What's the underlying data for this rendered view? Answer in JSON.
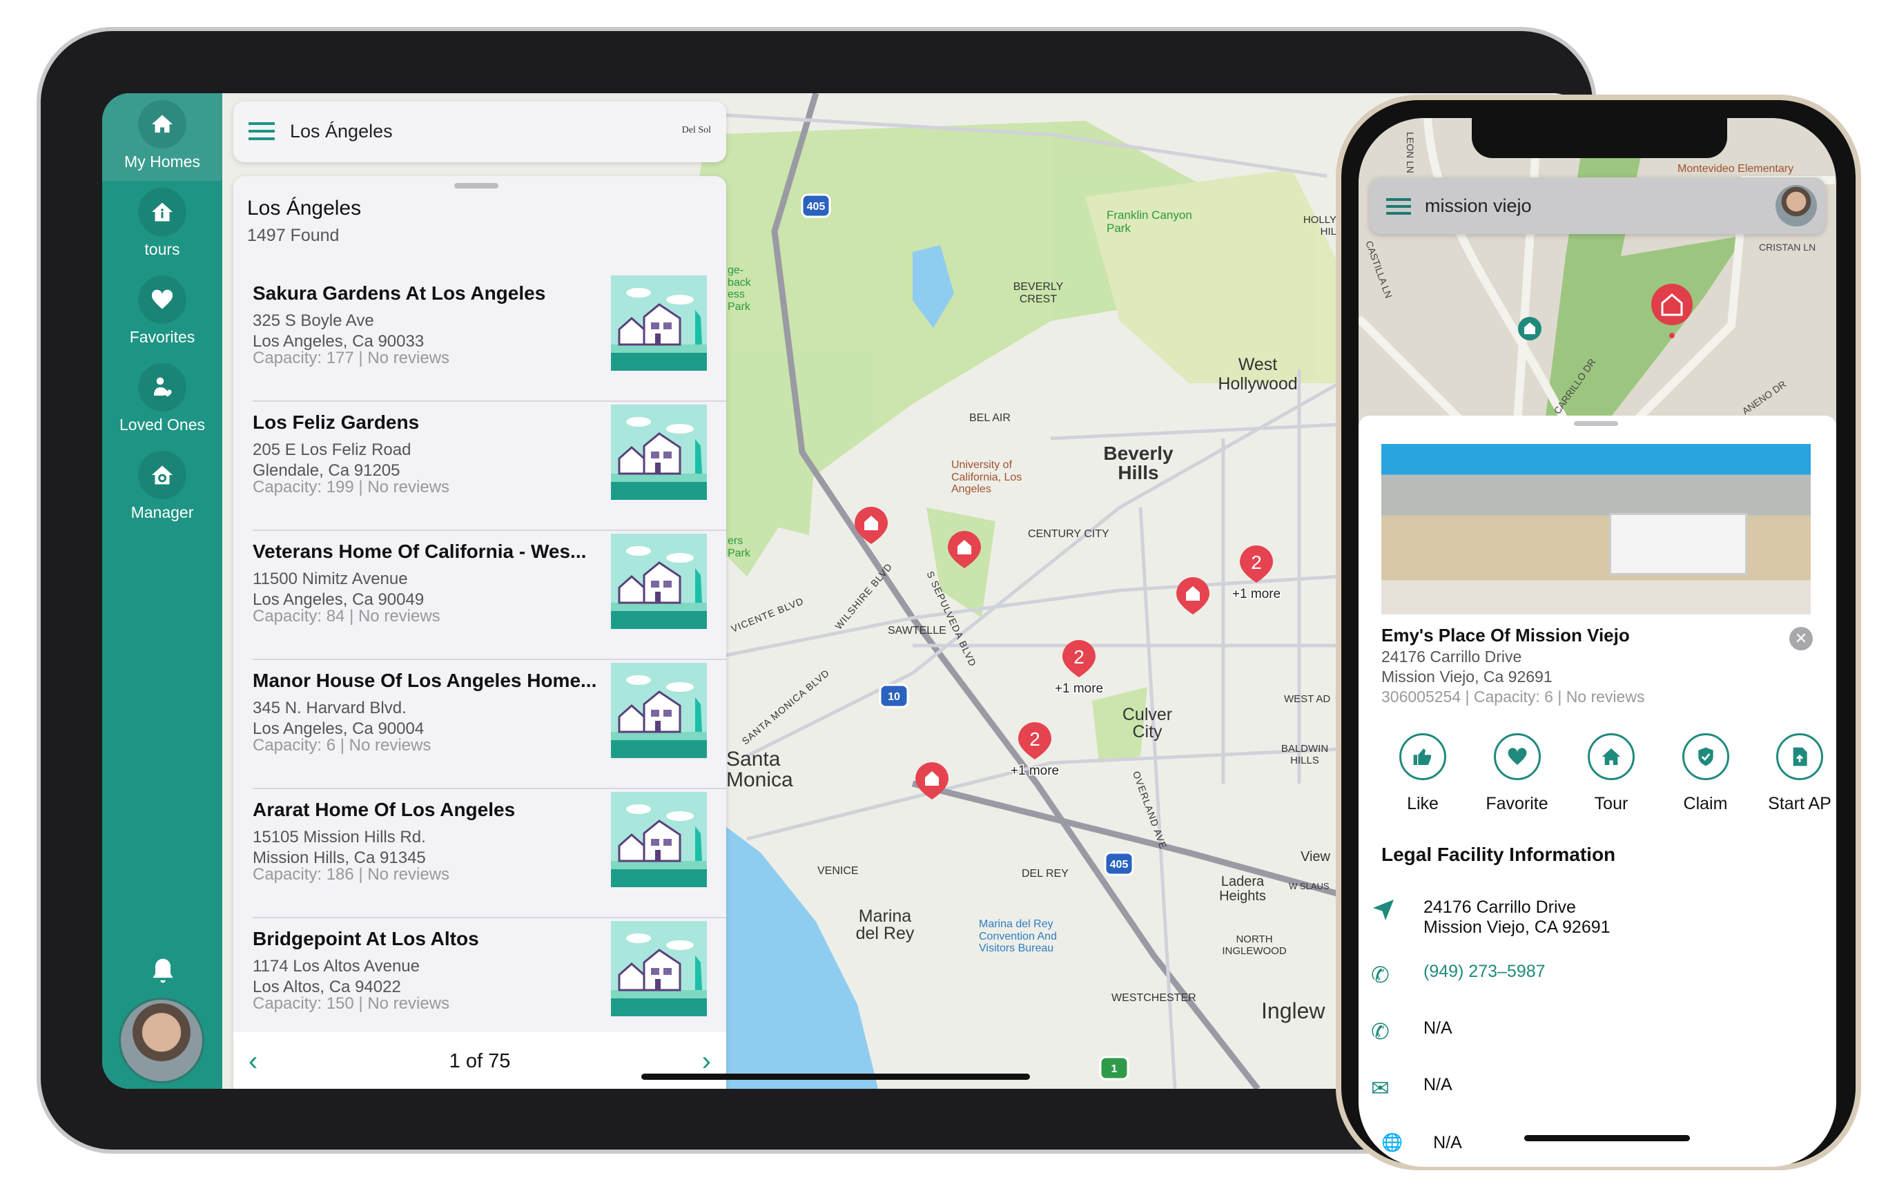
{
  "colors": {
    "brand": "#1e9484",
    "pin": "#e5434f",
    "map_bg": "#eeeee8",
    "park": "#bfe0a0"
  },
  "ipad": {
    "sidebar": {
      "items": [
        {
          "label": "My Homes",
          "icon": "home-icon",
          "active": true
        },
        {
          "label": "tours",
          "icon": "home-info-icon"
        },
        {
          "label": "Favorites",
          "icon": "heart-icon"
        },
        {
          "label": "Loved Ones",
          "icon": "person-heart-icon"
        },
        {
          "label": "Manager",
          "icon": "home-gear-icon"
        }
      ],
      "bell_icon": "bell-icon",
      "avatar": "user-avatar"
    },
    "search": {
      "value": "Los Ángeles",
      "logo": "Del Sol"
    },
    "results": {
      "title": "Los Ángeles",
      "count": "1497 Found",
      "items": [
        {
          "name": "Sakura Gardens At Los Angeles",
          "line1": "325 S Boyle Ave",
          "line2": "Los Angeles, Ca 90033",
          "meta": "Capacity: 177 | No reviews"
        },
        {
          "name": "Los Feliz Gardens",
          "line1": "205 E Los Feliz Road",
          "line2": "Glendale, Ca 91205",
          "meta": "Capacity: 199 | No reviews"
        },
        {
          "name": "Veterans Home Of California - Wes...",
          "line1": "11500 Nimitz Avenue",
          "line2": "Los Angeles, Ca 90049",
          "meta": "Capacity: 84 | No reviews"
        },
        {
          "name": "Manor House Of Los Angeles Home...",
          "line1": "345 N. Harvard Blvd.",
          "line2": "Los Angeles, Ca 90004",
          "meta": "Capacity: 6 | No reviews"
        },
        {
          "name": "Ararat Home Of Los Angeles",
          "line1": "15105 Mission Hills Rd.",
          "line2": "Mission Hills, Ca 91345",
          "meta": "Capacity: 186 | No reviews"
        },
        {
          "name": "Bridgepoint At Los Altos",
          "line1": "1174 Los Altos Avenue",
          "line2": "Los Altos, Ca 94022",
          "meta": "Capacity: 150 | No reviews"
        }
      ],
      "pagination": "1 of 75"
    },
    "map": {
      "labels": {
        "franklin": "Franklin Canyon Park",
        "beverly_crest": "BEVERLY CREST",
        "west_hollywood": "West Hollywood",
        "bel_air": "BEL AIR",
        "ucla": "University of California, Los Angeles",
        "beverly_hills": "Beverly Hills",
        "century_city": "CENTURY CITY",
        "sawtelle": "SAWTELLE",
        "culver_city": "Culver City",
        "santa_monica": "Santa Monica",
        "venice": "VENICE",
        "del_rey": "DEL REY",
        "marina": "Marina del Rey",
        "marina_bureau": "Marina del Rey Convention And Visitors Bureau",
        "ladera": "Ladera Heights",
        "north_inglewood": "NORTH INGLEWOOD",
        "westchester": "WESTCHESTER",
        "inglewood": "Inglew",
        "baldwin": "BALDWIN HILLS",
        "west_adams": "WEST AD",
        "view": "View",
        "sepulveda": "S SEPULVEDA BLVD",
        "wilshire": "WILSHIRE BLVD",
        "santa_monica_blvd": "SANTA MONICA BLVD",
        "overland": "OVERLAND AVE",
        "vicente": "VICENTE BLVD",
        "hollywood_hills": "HOLLY HIL",
        "w_slauson": "W SLAUS",
        "park_partial": "ge- back ess Park",
        "park_partial2": "ers Park"
      },
      "shields": [
        "405",
        "10",
        "405",
        "1"
      ],
      "clusters": [
        {
          "count": "2",
          "more": "+1 more"
        },
        {
          "count": "2",
          "more": "+1 more"
        },
        {
          "count": "2",
          "more": "+1 more"
        }
      ]
    }
  },
  "phone": {
    "search": {
      "value": "mission viejo",
      "avatar": "user-avatar"
    },
    "map_labels": {
      "montevideo": "Montevideo Elementary",
      "cristan": "CRISTAN LN",
      "carrillo": "CARRILLO DR",
      "castilla": "CASTILLA LN",
      "leon": "LEON LN",
      "aneno": "ANENO DR"
    },
    "facility": {
      "name": "Emy's Place Of Mission Viejo",
      "line1": "24176 Carrillo Drive",
      "line2": "Mission Viejo, Ca 92691",
      "meta": "306005254 | Capacity: 6 | No reviews",
      "actions": [
        {
          "label": "Like",
          "icon": "thumbs-up-icon"
        },
        {
          "label": "Favorite",
          "icon": "heart-icon"
        },
        {
          "label": "Tour",
          "icon": "home-icon"
        },
        {
          "label": "Claim",
          "icon": "shield-check-icon"
        },
        {
          "label": "Start AP",
          "icon": "document-upload-icon"
        }
      ],
      "legal_title": "Legal Facility Information",
      "legal": {
        "address1": "24176 Carrillo Drive",
        "address2": "Mission Viejo, CA 92691",
        "phone": "(949) 273–5987",
        "phone2": "N/A",
        "email": "N/A",
        "website": "N/A"
      },
      "phone_color": "#1f8a7c"
    }
  }
}
